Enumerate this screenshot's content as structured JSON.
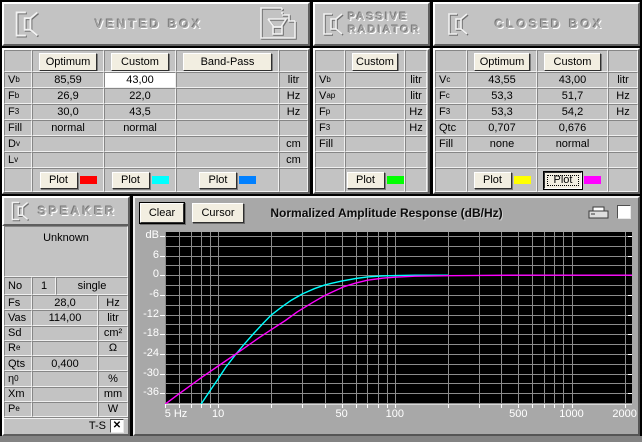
{
  "vented_box": {
    "title": "VENTED BOX",
    "columns": [
      "Optimum",
      "Custom",
      "Band-Pass"
    ],
    "rows": [
      {
        "label": {
          "t": "V",
          "s": "b"
        },
        "values": [
          "85,59",
          "43,00",
          ""
        ],
        "unit": "litr",
        "editable_col": 1
      },
      {
        "label": {
          "t": "F",
          "s": "b"
        },
        "values": [
          "26,9",
          "22,0",
          ""
        ],
        "unit": "Hz"
      },
      {
        "label": {
          "t": "F",
          "s": "3"
        },
        "values": [
          "30,0",
          "43,5",
          ""
        ],
        "unit": "Hz"
      },
      {
        "label": {
          "t": "Fill",
          "s": ""
        },
        "values": [
          "normal",
          "normal",
          ""
        ],
        "unit": ""
      },
      {
        "label": {
          "t": "D",
          "s": "v"
        },
        "values": [
          "",
          "",
          ""
        ],
        "unit": "cm"
      },
      {
        "label": {
          "t": "L",
          "s": "v"
        },
        "values": [
          "",
          "",
          ""
        ],
        "unit": "cm"
      }
    ],
    "plot_buttons": [
      {
        "label": "Plot",
        "color": "#ff0000",
        "color_name": "red"
      },
      {
        "label": "Plot",
        "color": "#00ffff",
        "color_name": "cyan"
      },
      {
        "label": "Plot",
        "color": "#0080ff",
        "color_name": "blue"
      }
    ]
  },
  "passive_radiator": {
    "title_line1": "PASSIVE",
    "title_line2": "RADIATOR",
    "columns": [
      "Custom"
    ],
    "rows": [
      {
        "label": {
          "t": "V",
          "s": "b"
        },
        "values": [
          ""
        ],
        "unit": "litr"
      },
      {
        "label": {
          "t": "V",
          "s": "ap"
        },
        "values": [
          ""
        ],
        "unit": "litr"
      },
      {
        "label": {
          "t": "F",
          "s": "p"
        },
        "values": [
          ""
        ],
        "unit": "Hz"
      },
      {
        "label": {
          "t": "F",
          "s": "3"
        },
        "values": [
          ""
        ],
        "unit": "Hz"
      },
      {
        "label": {
          "t": "Fill",
          "s": ""
        },
        "values": [
          ""
        ],
        "unit": ""
      },
      {
        "label": {
          "t": "",
          "s": ""
        },
        "values": [
          ""
        ],
        "unit": ""
      }
    ],
    "plot_buttons": [
      {
        "label": "Plot",
        "color": "#00ff00",
        "color_name": "green"
      }
    ]
  },
  "closed_box": {
    "title": "CLOSED BOX",
    "columns": [
      "Optimum",
      "Custom"
    ],
    "rows": [
      {
        "label": {
          "t": "V",
          "s": "c"
        },
        "values": [
          "43,55",
          "43,00"
        ],
        "unit": "litr"
      },
      {
        "label": {
          "t": "F",
          "s": "c"
        },
        "values": [
          "53,3",
          "51,7"
        ],
        "unit": "Hz"
      },
      {
        "label": {
          "t": "F",
          "s": "3"
        },
        "values": [
          "53,3",
          "54,2"
        ],
        "unit": "Hz"
      },
      {
        "label": {
          "t": "Qtc",
          "s": ""
        },
        "values": [
          "0,707",
          "0,676"
        ],
        "unit": ""
      },
      {
        "label": {
          "t": "Fill",
          "s": ""
        },
        "values": [
          "none",
          "normal"
        ],
        "unit": ""
      },
      {
        "label": {
          "t": "",
          "s": ""
        },
        "values": [
          "",
          ""
        ],
        "unit": ""
      }
    ],
    "plot_buttons": [
      {
        "label": "Plot",
        "color": "#ffff00",
        "color_name": "yellow"
      },
      {
        "label": "Plot",
        "color": "#ff00ff",
        "color_name": "magenta",
        "focused": true
      }
    ]
  },
  "speaker": {
    "title": "SPEAKER",
    "driver_name": "Unknown",
    "no_row": {
      "label": "No",
      "value": "1",
      "mode": "single"
    },
    "rows": [
      {
        "label": {
          "t": "Fs",
          "s": ""
        },
        "value": "28,0",
        "unit": "Hz"
      },
      {
        "label": {
          "t": "Vas",
          "s": ""
        },
        "value": "114,00",
        "unit": "litr"
      },
      {
        "label": {
          "t": "Sd",
          "s": ""
        },
        "value": "",
        "unit": "cm²"
      },
      {
        "label": {
          "t": "R",
          "s": "e"
        },
        "value": "",
        "unit": "Ω"
      },
      {
        "label": {
          "t": "Qts",
          "s": ""
        },
        "value": "0,400",
        "unit": ""
      },
      {
        "label": {
          "t": "η",
          "s": "0"
        },
        "value": "",
        "unit": "%"
      },
      {
        "label": {
          "t": "Xm",
          "s": ""
        },
        "value": "",
        "unit": "mm"
      },
      {
        "label": {
          "t": "P",
          "s": "e"
        },
        "value": "",
        "unit": "W"
      }
    ],
    "ts": {
      "label": "T-S",
      "checked": true,
      "mark": "✕"
    }
  },
  "chart": {
    "clear_label": "Clear",
    "cursor_label": "Cursor",
    "option_checkbox_checked": false
  },
  "chart_data": {
    "type": "line",
    "title": "Normalized Amplitude Response (dB/Hz)",
    "bg_color": "#000000",
    "grid_color": "#8c8c8c",
    "x_axis": {
      "scale": "log",
      "min": 5,
      "max": 2200,
      "unit": "Hz",
      "labeled_ticks": [
        {
          "f": 5,
          "label": "5 Hz"
        },
        {
          "f": 10,
          "label": "10"
        },
        {
          "f": 50,
          "label": "50"
        },
        {
          "f": 100,
          "label": "100"
        },
        {
          "f": 500,
          "label": "500"
        },
        {
          "f": 1000,
          "label": "1000"
        },
        {
          "f": 2000,
          "label": "2000"
        }
      ],
      "gridlines": [
        5,
        6,
        7,
        8,
        9,
        10,
        20,
        30,
        40,
        50,
        60,
        70,
        80,
        90,
        100,
        200,
        300,
        400,
        500,
        600,
        700,
        800,
        900,
        1000,
        2000
      ]
    },
    "y_axis": {
      "min": -39.3,
      "max": 13.2,
      "unit": "dB",
      "grid_step": 3,
      "labeled_ticks": [
        {
          "db": 12,
          "label": "dB"
        },
        {
          "db": 6,
          "label": "6"
        },
        {
          "db": 0,
          "label": "0"
        },
        {
          "db": -6,
          "label": "-6"
        },
        {
          "db": -12,
          "label": "-12"
        },
        {
          "db": -18,
          "label": "-18"
        },
        {
          "db": -24,
          "label": "-24"
        },
        {
          "db": -30,
          "label": "-30"
        },
        {
          "db": -36,
          "label": "-36"
        }
      ]
    },
    "series": [
      {
        "name": "vented-box-custom",
        "color": "#00ffff",
        "points": [
          [
            8,
            -39.3
          ],
          [
            9,
            -35.2
          ],
          [
            10,
            -31.6
          ],
          [
            11,
            -28.2
          ],
          [
            12.5,
            -24.3
          ],
          [
            14,
            -21.1
          ],
          [
            16,
            -17.6
          ],
          [
            18,
            -14.6
          ],
          [
            20,
            -12.1
          ],
          [
            23,
            -9.6
          ],
          [
            26,
            -7.6
          ],
          [
            30,
            -5.7
          ],
          [
            35,
            -4.1
          ],
          [
            40,
            -3.0
          ],
          [
            43.5,
            -2.5
          ],
          [
            50,
            -1.8
          ],
          [
            60,
            -1.0
          ],
          [
            70,
            -0.5
          ],
          [
            85,
            -0.2
          ],
          [
            100,
            -0.1
          ],
          [
            130,
            0
          ],
          [
            200,
            0
          ]
        ]
      },
      {
        "name": "closed-box-custom",
        "color": "#ff00ff",
        "points": [
          [
            5,
            -39.4
          ],
          [
            6,
            -36.2
          ],
          [
            7,
            -33.6
          ],
          [
            8,
            -31.3
          ],
          [
            9,
            -29.4
          ],
          [
            10,
            -27.7
          ],
          [
            12,
            -24.8
          ],
          [
            14,
            -22.3
          ],
          [
            17,
            -19.1
          ],
          [
            20,
            -16.6
          ],
          [
            24,
            -13.8
          ],
          [
            28,
            -11.2
          ],
          [
            34,
            -8.4
          ],
          [
            40,
            -6.2
          ],
          [
            46,
            -4.7
          ],
          [
            52,
            -3.4
          ],
          [
            60,
            -2.4
          ],
          [
            70,
            -1.5
          ],
          [
            85,
            -0.9
          ],
          [
            100,
            -0.6
          ],
          [
            130,
            -0.3
          ],
          [
            200,
            -0.15
          ],
          [
            300,
            -0.05
          ],
          [
            500,
            0
          ],
          [
            1000,
            0
          ],
          [
            2200,
            0
          ]
        ]
      }
    ]
  }
}
